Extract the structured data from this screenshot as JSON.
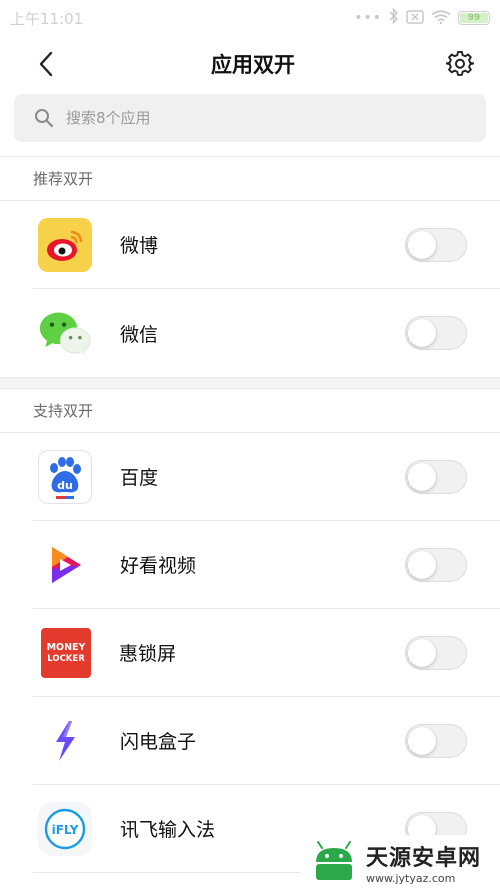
{
  "status_bar": {
    "time": "上午11:01",
    "battery": "99"
  },
  "header": {
    "title": "应用双开"
  },
  "search": {
    "placeholder": "搜索8个应用"
  },
  "sections": [
    {
      "title": "推荐双开",
      "apps": [
        {
          "name": "微博",
          "icon": "weibo-icon",
          "enabled": false
        },
        {
          "name": "微信",
          "icon": "wechat-icon",
          "enabled": false
        }
      ]
    },
    {
      "title": "支持双开",
      "apps": [
        {
          "name": "百度",
          "icon": "baidu-icon",
          "enabled": false
        },
        {
          "name": "好看视频",
          "icon": "haokan-video-icon",
          "enabled": false
        },
        {
          "name": "惠锁屏",
          "icon": "money-locker-icon",
          "icon_text": "MONEY LOCKER",
          "enabled": false
        },
        {
          "name": "闪电盒子",
          "icon": "lightning-box-icon",
          "enabled": false
        },
        {
          "name": "讯飞输入法",
          "icon": "ifly-icon",
          "icon_text": "iFLY",
          "enabled": false
        }
      ]
    }
  ],
  "watermark": {
    "title": "天源安卓网",
    "url": "www.jytyaz.com"
  },
  "colors": {
    "toggle_off_bg": "#f1f1f1",
    "divider": "#e6e6e6",
    "section_title": "#6a6a6a"
  }
}
